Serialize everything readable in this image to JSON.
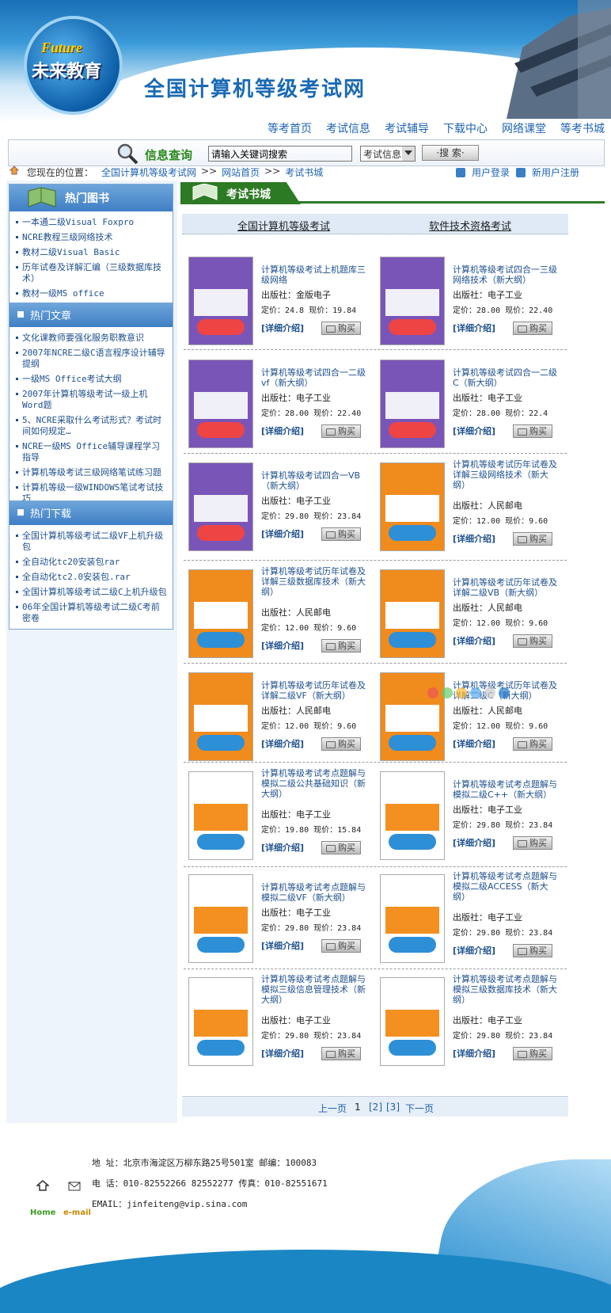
{
  "header": {
    "logo_en": "Future",
    "logo_cn": "未来教育",
    "site_title": "全国计算机等级考试网"
  },
  "topnav": [
    "等考首页",
    "考试信息",
    "考试辅导",
    "下载中心",
    "网络课堂",
    "等考书城"
  ],
  "search": {
    "label": "信息查询",
    "value": "请输入关键词搜索",
    "select_value": "考试信息",
    "button": "·搜 索·"
  },
  "breadcrumb": {
    "lead": "您现在的位置：",
    "items": [
      "全国计算机等级考试网",
      ">>",
      "网站首页",
      ">>",
      "考试书城"
    ],
    "login": "用户登录",
    "register": "新用户注册"
  },
  "sidebar": {
    "hot_books": {
      "title": "热门图书",
      "items": [
        "一本通二级Visual Foxpro",
        "NCRE教程三级网络技术",
        "教材二级Visual Basic",
        "历年试卷及详解汇编（三级数据库技术）",
        "教材一级MS office"
      ]
    },
    "hot_articles": {
      "title": "热门文章",
      "items": [
        "文化课教师要强化服务职教意识",
        "2007年NCRE二级C语言程序设计辅导提纲",
        "一级MS Office考试大纲",
        "2007年计算机等级考试一级上机Word题",
        "5、NCRE采取什么考试形式？考试时间如何规定…",
        "NCRE一级MS Office辅导课程学习指导",
        "计算机等级考试三级网络笔试练习题",
        "计算机等级一级WINDOWS笔试考试技巧"
      ]
    },
    "hot_downloads": {
      "title": "热门下载",
      "items": [
        "全国计算机等级考试二级VF上机升级包",
        "全自动化tc20安装包rar",
        "全自动化tc2.0安装包.rar",
        "全国计算机等级考试二级C上机升级包",
        "06年全国计算机等级考试二级C考前密卷"
      ]
    }
  },
  "main": {
    "section_title": "考试书城",
    "tabs": [
      "全国计算机等级考试",
      "软件技术资格考试"
    ],
    "detail_label": "[详细介绍]",
    "buy_label": "购买",
    "pub_prefix": "出版社：",
    "books": [
      {
        "title": "计算机等级考试上机题库三级网络",
        "publisher": "金版电子",
        "price": "定价：24.8 现价：19.84",
        "cover": "purple"
      },
      {
        "title": "计算机等级考试四合一三级网络技术（新大纲）",
        "publisher": "电子工业",
        "price": "定价：28.00 现价：22.40",
        "cover": "purple"
      },
      {
        "title": "计算机等级考试四合一二级vf（新大纲）",
        "publisher": "电子工业",
        "price": "定价：28.00 现价：22.40",
        "cover": "purple"
      },
      {
        "title": "计算机等级考试四合一二级C（新大纲）",
        "publisher": "电子工业",
        "price": "定价：28.00 现价：22.4",
        "cover": "purple"
      },
      {
        "title": "计算机等级考试四合一VB（新大纲）",
        "publisher": "电子工业",
        "price": "定价：29.80 现价：23.84",
        "cover": "purple"
      },
      {
        "title": "计算机等级考试历年试卷及详解三级网络技术（新大纲）",
        "publisher": "人民邮电",
        "price": "定价：12.00 现价：9.60",
        "cover": "orange"
      },
      {
        "title": "计算机等级考试历年试卷及详解三级数据库技术（新大纲）",
        "publisher": "人民邮电",
        "price": "定价：12.00 现价：9.60",
        "cover": "orange"
      },
      {
        "title": "计算机等级考试历年试卷及详解二级VB（新大纲）",
        "publisher": "人民邮电",
        "price": "定价：12.00 现价：9.60",
        "cover": "orange"
      },
      {
        "title": "计算机等级考试历年试卷及详解二级VF（新大纲）",
        "publisher": "人民邮电",
        "price": "定价：12.00 现价：9.60",
        "cover": "orange"
      },
      {
        "title": "计算机等级考试历年试卷及详解二级C（新大纲）",
        "publisher": "人民邮电",
        "price": "定价：12.00 现价：9.60",
        "cover": "orange"
      },
      {
        "title": "计算机等级考试考点题解与模拟二级公共基础知识（新大纲）",
        "publisher": "电子工业",
        "price": "定价：19.80 现价：15.84",
        "cover": "white"
      },
      {
        "title": "计算机等级考试考点题解与模拟二级C++（新大纲）",
        "publisher": "电子工业",
        "price": "定价：29.80 现价：23.84",
        "cover": "white"
      },
      {
        "title": "计算机等级考试考点题解与模拟二级VF（新大纲）",
        "publisher": "电子工业",
        "price": "定价：29.80 现价：23.84",
        "cover": "white"
      },
      {
        "title": "计算机等级考试考点题解与模拟二级ACCESS（新大纲）",
        "publisher": "电子工业",
        "price": "定价：29.80 现价：23.84",
        "cover": "white"
      },
      {
        "title": "计算机等级考试考点题解与模拟三级信息管理技术（新大纲）",
        "publisher": "电子工业",
        "price": "定价：29.80 现价：23.84",
        "cover": "white"
      },
      {
        "title": "计算机等级考试考点题解与模拟三级数据库技术（新大纲）",
        "publisher": "电子工业",
        "price": "定价：29.80 现价：23.84",
        "cover": "white"
      }
    ],
    "pager": {
      "prev": "上一页",
      "current": "1",
      "p2": "[2]",
      "p3": "[3]",
      "next": "下一页"
    }
  },
  "footer": {
    "address": "地 址：北京市海淀区万柳东路25号501室  邮编：100083",
    "phone": "电 话：010-82552266 82552277 传真：010-82551671",
    "email": "EMAIL：jinfeiteng@vip.sina.com",
    "home": "Home",
    "mail": "e-mail"
  },
  "colors": {
    "brand_blue": "#1a6ab3",
    "green": "#2d7a24",
    "link": "#1d63b0"
  }
}
